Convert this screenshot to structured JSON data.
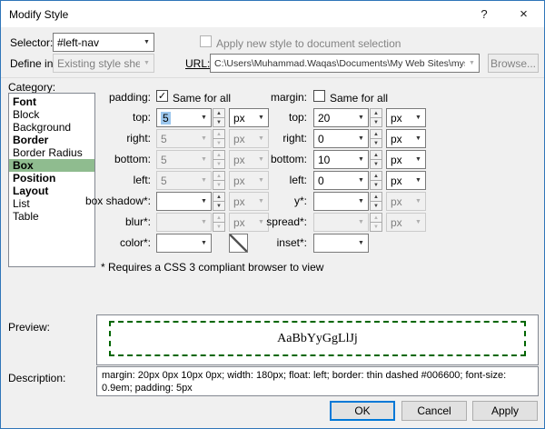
{
  "window": {
    "title": "Modify Style"
  },
  "icons": {
    "help": "?",
    "close": "×",
    "dropdown": "▼",
    "spin_up": "▲",
    "spin_down": "▼",
    "check": "✓"
  },
  "header": {
    "selector_label": "Selector:",
    "selector_value": "#left-nav",
    "apply_checkbox_label": "Apply new style to document selection",
    "define_in_label": "Define in:",
    "define_in_value": "Existing style sheet",
    "url_label": "URL:",
    "url_value": "C:\\Users\\Muhammad.Waqas\\Documents\\My Web Sites\\mysite\\sample.css",
    "browse_button": "Browse..."
  },
  "category": {
    "label": "Category:",
    "items": [
      {
        "label": "Font",
        "bold": true,
        "selected": false
      },
      {
        "label": "Block",
        "bold": false,
        "selected": false
      },
      {
        "label": "Background",
        "bold": false,
        "selected": false
      },
      {
        "label": "Border",
        "bold": true,
        "selected": false
      },
      {
        "label": "Border Radius",
        "bold": false,
        "selected": false
      },
      {
        "label": "Box",
        "bold": true,
        "selected": true
      },
      {
        "label": "Position",
        "bold": true,
        "selected": false
      },
      {
        "label": "Layout",
        "bold": true,
        "selected": false
      },
      {
        "label": "List",
        "bold": false,
        "selected": false
      },
      {
        "label": "Table",
        "bold": false,
        "selected": false
      }
    ]
  },
  "box": {
    "padding_label": "padding:",
    "padding_same_label": "Same for all",
    "padding_same_checked": true,
    "margin_label": "margin:",
    "margin_same_label": "Same for all",
    "margin_same_checked": false,
    "padding_rows": [
      {
        "label": "top:",
        "value": "5",
        "unit": "px",
        "enabled": true
      },
      {
        "label": "right:",
        "value": "5",
        "unit": "px",
        "enabled": false
      },
      {
        "label": "bottom:",
        "value": "5",
        "unit": "px",
        "enabled": false
      },
      {
        "label": "left:",
        "value": "5",
        "unit": "px",
        "enabled": false
      }
    ],
    "margin_rows": [
      {
        "label": "top:",
        "value": "20",
        "unit": "px",
        "enabled": true
      },
      {
        "label": "right:",
        "value": "0",
        "unit": "px",
        "enabled": true
      },
      {
        "label": "bottom:",
        "value": "10",
        "unit": "px",
        "enabled": true
      },
      {
        "label": "left:",
        "value": "0",
        "unit": "px",
        "enabled": true
      }
    ],
    "shadow_left": [
      {
        "label": "box shadow*:",
        "value": "",
        "unit": "px",
        "enabled": true
      },
      {
        "label": "blur*:",
        "value": "",
        "unit": "px",
        "enabled": false
      },
      {
        "label": "color*:",
        "value": "",
        "enabled": true
      }
    ],
    "shadow_right": [
      {
        "label": "y*:",
        "value": "",
        "unit": "px",
        "enabled": true
      },
      {
        "label": "spread*:",
        "value": "",
        "unit": "px",
        "enabled": false
      },
      {
        "label": "inset*:",
        "value": "",
        "enabled": true
      }
    ],
    "footnote": "* Requires a CSS 3 compliant browser to view"
  },
  "preview": {
    "label": "Preview:",
    "sample": "AaBbYyGgLlJj"
  },
  "description": {
    "label": "Description:",
    "text": "margin: 20px 0px 10px 0px; width: 180px; float: left; border: thin dashed #006600; font-size: 0.9em; padding: 5px"
  },
  "buttons": {
    "ok": "OK",
    "cancel": "Cancel",
    "apply": "Apply"
  },
  "colors": {
    "accent": "#0078d7",
    "category_selected_bg": "#8fbc8f",
    "preview_border": "#006600"
  }
}
